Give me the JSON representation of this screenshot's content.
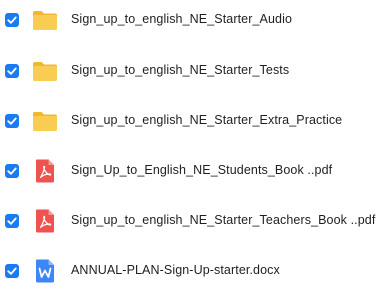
{
  "files": [
    {
      "name": "Sign_up_to_english_NE_Starter_Audio",
      "icon": "folder-icon",
      "checked": true
    },
    {
      "name": "Sign_up_to_english_NE_Starter_Tests",
      "icon": "folder-icon",
      "checked": true
    },
    {
      "name": "Sign_up_to_english_NE_Starter_Extra_Practice",
      "icon": "folder-icon",
      "checked": true
    },
    {
      "name": "Sign_Up_to_English_NE_Students_Book ..pdf",
      "icon": "pdf-icon",
      "checked": true
    },
    {
      "name": "Sign_up_to_english_NE_Starter_Teachers_Book ..pdf",
      "icon": "pdf-icon",
      "checked": true
    },
    {
      "name": "ANNUAL-PLAN-Sign-Up-starter.docx",
      "icon": "word-doc-icon",
      "checked": true
    }
  ],
  "colors": {
    "checkbox": "#1a7cf2",
    "folder": "#f6c94d",
    "pdf": "#ef4a4a",
    "word": "#3b82f6",
    "text": "#1f1f1f"
  }
}
